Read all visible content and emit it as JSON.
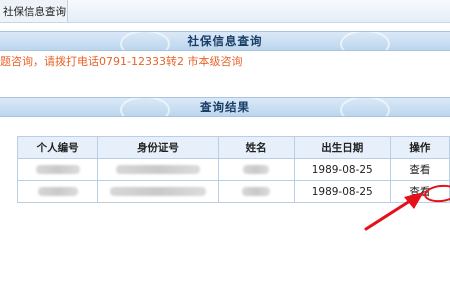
{
  "tab": {
    "title": "社保信息查询"
  },
  "banner_query": {
    "title": "社保信息查询"
  },
  "notice": {
    "text": "题咨询，请拨打电话0791-12333转2 市本级咨询"
  },
  "banner_results": {
    "title": "查询结果"
  },
  "table": {
    "headers": [
      "个人编号",
      "身份证号",
      "姓名",
      "出生日期",
      "操作"
    ],
    "rows": [
      {
        "birth_date": "1989-08-25",
        "action": "查看"
      },
      {
        "birth_date": "1989-08-25",
        "action": "查看"
      }
    ]
  },
  "colors": {
    "notice_text": "#e8632a",
    "banner_title": "#1a3e66",
    "annotation_red": "#e5111a",
    "table_border": "#b8cfe5",
    "header_bg": "#e7f0fa"
  }
}
